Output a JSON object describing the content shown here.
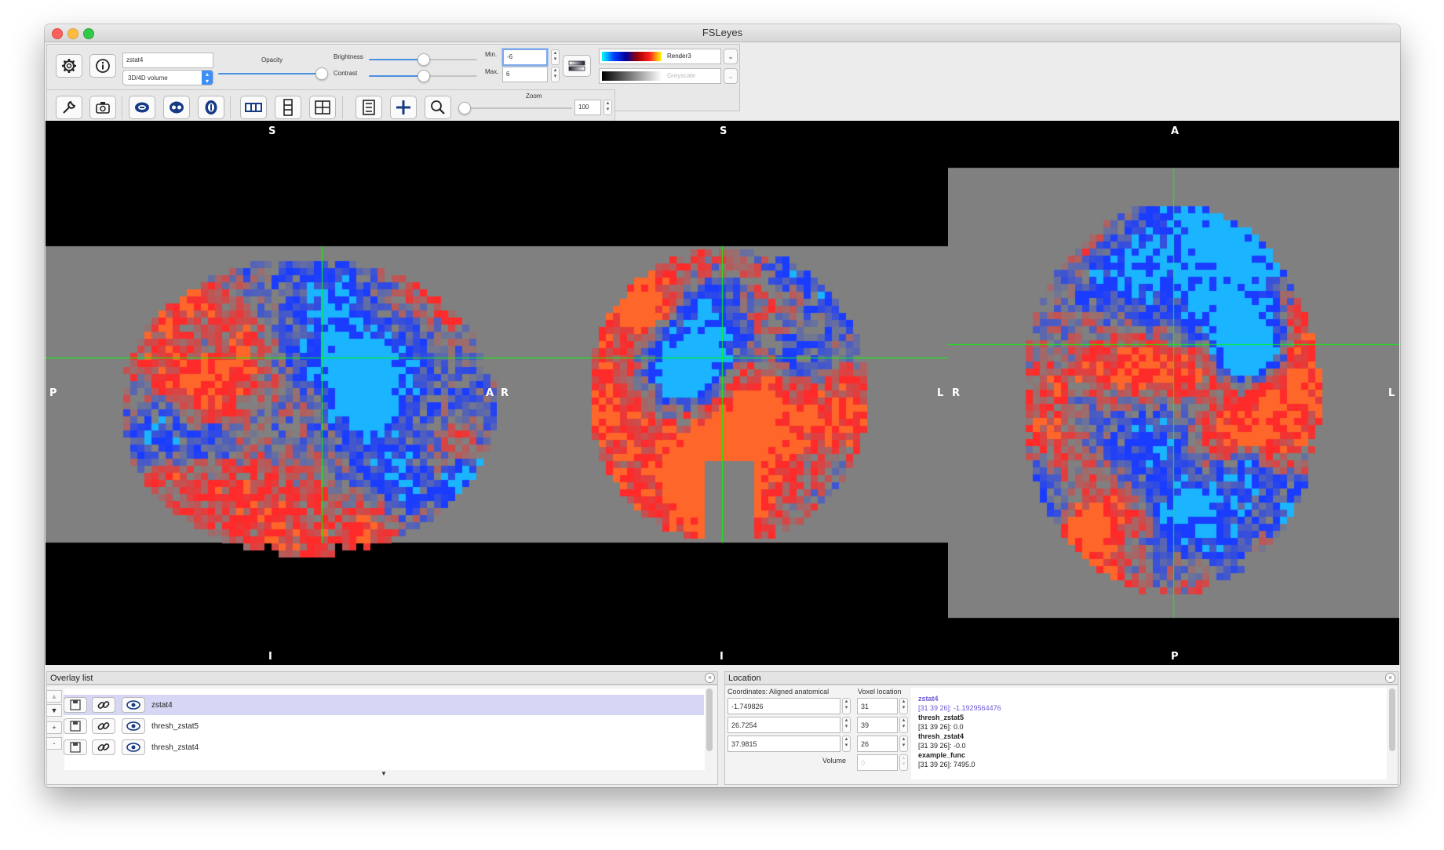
{
  "window": {
    "title": "FSLeyes"
  },
  "toolbar": {
    "overlay_name": "zstat4",
    "overlay_type": "3D/4D volume",
    "opacity_label": "Opacity",
    "opacity": 0.95,
    "brightness_label": "Brightness",
    "brightness": 0.5,
    "contrast_label": "Contrast",
    "contrast": 0.5,
    "min_label": "Min.",
    "min_value": "-6",
    "max_label": "Max.",
    "max_value": "6",
    "colormap1": "Render3",
    "colormap2": "Greyscale",
    "zoom_label": "Zoom",
    "zoom_value": "100",
    "zoom": 0.0,
    "icons": [
      "gear-icon",
      "info-icon",
      "wrench-icon",
      "camera-icon",
      "sagittal-icon",
      "coronal-icon",
      "axial-icon",
      "horizontal-layout-icon",
      "vertical-layout-icon",
      "grid-layout-icon",
      "movie-icon",
      "crosshair-icon",
      "zoom-icon"
    ]
  },
  "viewer": {
    "views": [
      {
        "top": "S",
        "bottom": "I",
        "left": "P",
        "right": "A"
      },
      {
        "top": "S",
        "bottom": "I",
        "left": "R",
        "right": "L"
      },
      {
        "top": "A",
        "bottom": "P",
        "left": "R",
        "right": "L"
      }
    ],
    "colors": {
      "background": "#000000",
      "slice": "#808080",
      "cursor": "#00ff00",
      "pos": "#ff2a2a",
      "neg": "#1a3cff"
    }
  },
  "overlay_list": {
    "title": "Overlay list",
    "items": [
      {
        "name": "zstat4",
        "selected": true
      },
      {
        "name": "thresh_zstat5",
        "selected": false
      },
      {
        "name": "thresh_zstat4",
        "selected": false
      }
    ]
  },
  "location": {
    "title": "Location",
    "coords_label": "Coordinates: Aligned anatomical",
    "voxel_label": "Voxel location",
    "coords": [
      "-1.749826",
      "26.7254",
      "37.9815"
    ],
    "voxels": [
      "31",
      "39",
      "26"
    ],
    "volume_label": "Volume",
    "volume_value": "0",
    "info": [
      {
        "name": "zstat4",
        "value": "[31 39 26]: -1.1929564476",
        "highlight": true
      },
      {
        "name": "thresh_zstat5",
        "value": "[31 39 26]: 0.0",
        "highlight": false
      },
      {
        "name": "thresh_zstat4",
        "value": "[31 39 26]: -0.0",
        "highlight": false
      },
      {
        "name": "example_func",
        "value": "[31 39 26]: 7495.0",
        "highlight": false
      }
    ]
  }
}
